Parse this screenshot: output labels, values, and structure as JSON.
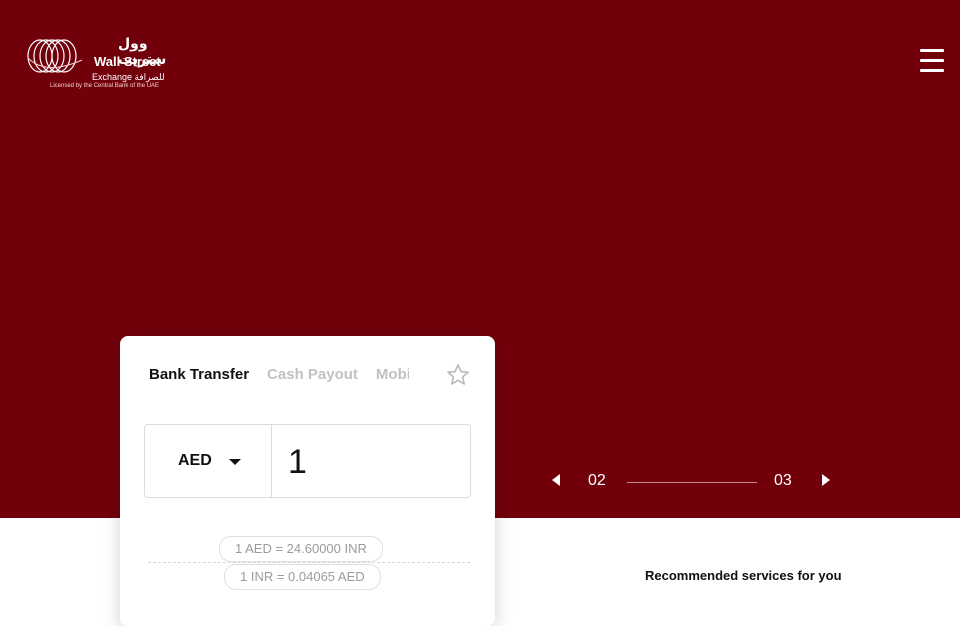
{
  "header": {
    "logo": {
      "arabic_name": "وول ستريت",
      "name": "Wall Street",
      "exchange": "Exchange للصرافة",
      "tagline": "Licensed by the Central Bank of the UAE"
    },
    "menu_icon": "hamburger-icon"
  },
  "hero": {
    "background_color": "#72000b",
    "slider": {
      "current": "02",
      "total": "03",
      "prev_icon": "triangle-left-icon",
      "next_icon": "triangle-right-icon"
    }
  },
  "converter": {
    "tabs": [
      {
        "label": "Bank Transfer",
        "active": true
      },
      {
        "label": "Cash Payout",
        "active": false
      },
      {
        "label": "Mobile Wallet",
        "active": false
      }
    ],
    "favorite_icon": "star-outline-icon",
    "currency": "AED",
    "amount": "1",
    "rates": [
      "1 AED = 24.60000 INR",
      "1 INR = 0.04065 AED"
    ]
  },
  "sections": {
    "recommended_title": "Recommended services for you"
  }
}
